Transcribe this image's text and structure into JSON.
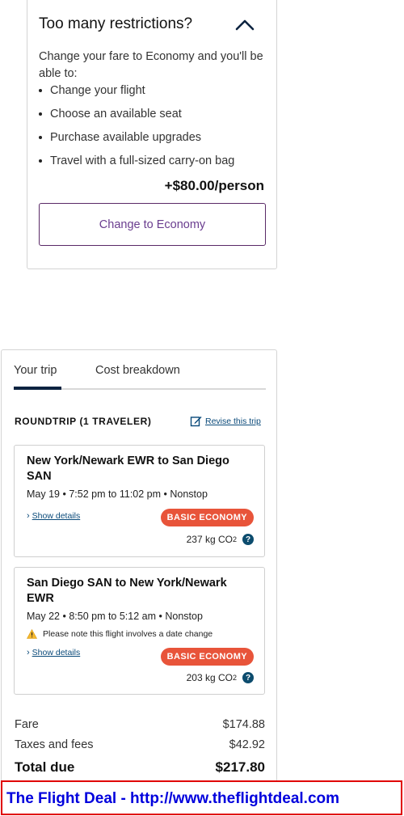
{
  "restrictions": {
    "title": "Too many restrictions?",
    "intro": "Change your fare to Economy and you'll be able to:",
    "benefits": [
      "Change your flight",
      "Choose an available seat",
      "Purchase available upgrades",
      "Travel with a full-sized carry-on bag"
    ],
    "price": "+$80.00/person",
    "button_label": "Change to Economy"
  },
  "trip": {
    "tabs": [
      "Your trip",
      "Cost breakdown"
    ],
    "header": "ROUNDTRIP (1 TRAVELER)",
    "revise_label": "Revise this trip",
    "flights": [
      {
        "route": "New York/Newark EWR to San Diego SAN",
        "times": "May 19 • 7:52 pm to 11:02 pm • Nonstop",
        "details_label": "Show details",
        "fare_class": "BASIC ECONOMY",
        "co2": "237 kg CO",
        "co2_sub": "2"
      },
      {
        "route": "San Diego SAN to New York/Newark EWR",
        "times": "May 22 • 8:50 pm to 5:12 am • Nonstop",
        "warning": "Please note this flight involves a date change",
        "details_label": "Show details",
        "fare_class": "BASIC ECONOMY",
        "co2": "203 kg CO",
        "co2_sub": "2"
      }
    ],
    "costs": {
      "fare_label": "Fare",
      "fare_value": "$174.88",
      "taxes_label": "Taxes and fees",
      "taxes_value": "$42.92",
      "total_label": "Total due",
      "total_value": "$217.80"
    }
  },
  "footer": {
    "text": "The Flight Deal - http://www.theflightdeal.com"
  },
  "colors": {
    "badge": "#e8543a",
    "button_border": "#5a2a67",
    "link": "#0a4a7a",
    "footer_text": "#0000dd",
    "footer_border": "#e00000"
  },
  "icons": {
    "collapse": "chevron-up-icon",
    "revise": "edit-icon",
    "details": "chevron-right-icon",
    "help": "question-icon",
    "warning": "warning-icon"
  }
}
